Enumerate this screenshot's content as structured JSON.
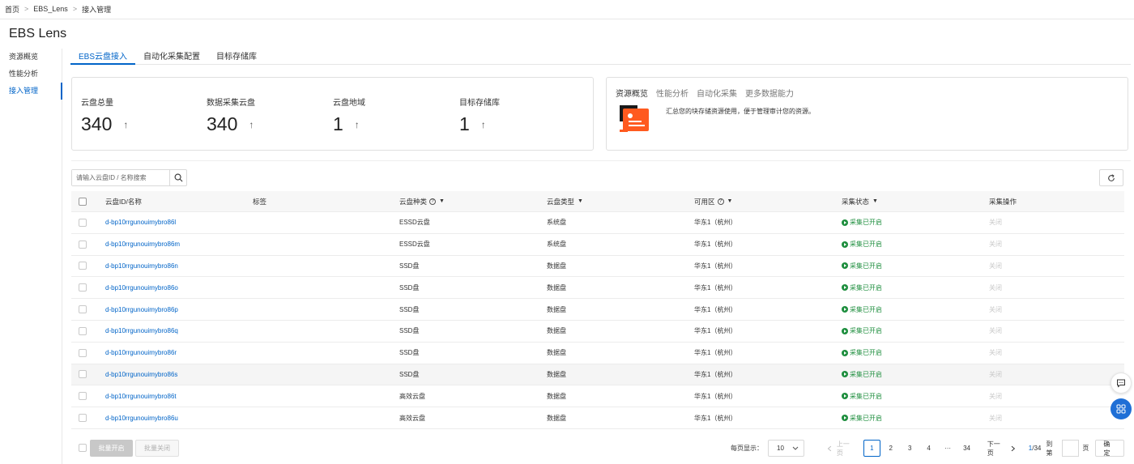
{
  "breadcrumb": [
    "首页",
    "EBS_Lens",
    "接入管理"
  ],
  "app_title": "EBS Lens",
  "sidebar": [
    {
      "label": "资源概览",
      "active": false
    },
    {
      "label": "性能分析",
      "active": false
    },
    {
      "label": "接入管理",
      "active": true
    }
  ],
  "tabs": [
    {
      "label": "EBS云盘接入",
      "active": true
    },
    {
      "label": "自动化采集配置",
      "active": false
    },
    {
      "label": "目标存储库",
      "active": false
    }
  ],
  "stats": [
    {
      "label": "云盘总量",
      "value": "340"
    },
    {
      "label": "数据采集云盘",
      "value": "340"
    },
    {
      "label": "云盘地域",
      "value": "1"
    },
    {
      "label": "目标存储库",
      "value": "1"
    }
  ],
  "info": {
    "tabs": [
      "资源概览",
      "性能分析",
      "自动化采集",
      "更多数据能力"
    ],
    "description": "汇总您的块存储资源使用，便于管理审计您的资源。"
  },
  "search": {
    "placeholder": "请输入云盘ID / 名称搜索"
  },
  "table": {
    "headers": {
      "id": "云盘ID/名称",
      "tag": "标签",
      "category": "云盘种类",
      "type": "云盘类型",
      "zone": "可用区",
      "status": "采集状态",
      "action": "采集操作"
    },
    "rows": [
      {
        "id": "d-bp10rrgunouimybro86l",
        "category": "ESSD云盘",
        "type": "系统盘",
        "zone": "华东1（杭州）",
        "status": "采集已开启",
        "action": "关闭"
      },
      {
        "id": "d-bp10rrgunouimybro86m",
        "category": "ESSD云盘",
        "type": "系统盘",
        "zone": "华东1（杭州）",
        "status": "采集已开启",
        "action": "关闭"
      },
      {
        "id": "d-bp10rrgunouimybro86n",
        "category": "SSD盘",
        "type": "数据盘",
        "zone": "华东1（杭州）",
        "status": "采集已开启",
        "action": "关闭"
      },
      {
        "id": "d-bp10rrgunouimybro86o",
        "category": "SSD盘",
        "type": "数据盘",
        "zone": "华东1（杭州）",
        "status": "采集已开启",
        "action": "关闭"
      },
      {
        "id": "d-bp10rrgunouimybro86p",
        "category": "SSD盘",
        "type": "数据盘",
        "zone": "华东1（杭州）",
        "status": "采集已开启",
        "action": "关闭"
      },
      {
        "id": "d-bp10rrgunouimybro86q",
        "category": "SSD盘",
        "type": "数据盘",
        "zone": "华东1（杭州）",
        "status": "采集已开启",
        "action": "关闭"
      },
      {
        "id": "d-bp10rrgunouimybro86r",
        "category": "SSD盘",
        "type": "数据盘",
        "zone": "华东1（杭州）",
        "status": "采集已开启",
        "action": "关闭"
      },
      {
        "id": "d-bp10rrgunouimybro86s",
        "category": "SSD盘",
        "type": "数据盘",
        "zone": "华东1（杭州）",
        "status": "采集已开启",
        "action": "关闭"
      },
      {
        "id": "d-bp10rrgunouimybro86t",
        "category": "高效云盘",
        "type": "数据盘",
        "zone": "华东1（杭州）",
        "status": "采集已开启",
        "action": "关闭"
      },
      {
        "id": "d-bp10rrgunouimybro86u",
        "category": "高效云盘",
        "type": "数据盘",
        "zone": "华东1（杭州）",
        "status": "采集已开启",
        "action": "关闭"
      }
    ]
  },
  "footer": {
    "bulk_enable": "批量开启",
    "bulk_disable": "批量关闭",
    "page_size_label": "每页显示：",
    "page_size": "10",
    "prev": "上一页",
    "next": "下一页",
    "pages": [
      "1",
      "2",
      "3",
      "4"
    ],
    "ellipsis": "···",
    "last_page": "34",
    "current_page": "1",
    "page_info": "1/34",
    "goto_label": "到第",
    "page_unit": "页",
    "confirm": "确定"
  },
  "colors": {
    "accent": "#0064c8",
    "success": "#1e8e3e",
    "float_button": "#1f6fd6"
  }
}
